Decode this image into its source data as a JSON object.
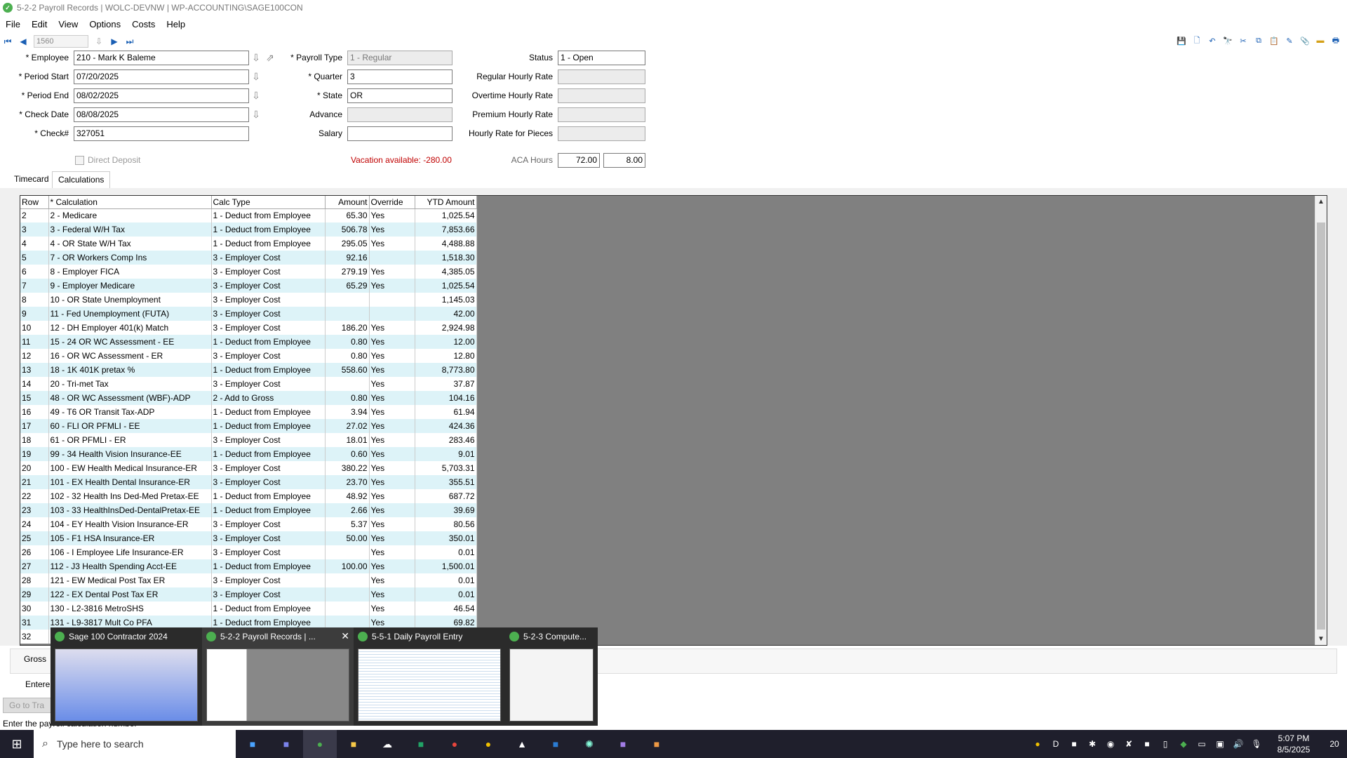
{
  "window": {
    "title": "5-2-2 Payroll Records  |  WOLC-DEVNW  |  WP-ACCOUNTING\\SAGE100CON"
  },
  "menu": [
    "File",
    "Edit",
    "View",
    "Options",
    "Costs",
    "Help"
  ],
  "nav": {
    "record": "1560"
  },
  "form": {
    "employee_label": "* Employee",
    "employee": "210 - Mark K Baleme",
    "period_start_label": "* Period Start",
    "period_start": "07/20/2025",
    "period_end_label": "* Period End",
    "period_end": "08/02/2025",
    "check_date_label": "* Check Date",
    "check_date": "08/08/2025",
    "check_label": "* Check#",
    "check": "327051",
    "direct_deposit_label": "Direct Deposit",
    "payroll_type_label": "* Payroll Type",
    "payroll_type": "1 - Regular",
    "quarter_label": "* Quarter",
    "quarter": "3",
    "state_label": "* State",
    "state": "OR",
    "advance_label": "Advance",
    "advance": "",
    "salary_label": "Salary",
    "salary": "",
    "vacation_label": "Vacation available:",
    "vacation": "-280.00",
    "status_label": "Status",
    "status": "1 - Open",
    "regular_rate_label": "Regular Hourly Rate",
    "overtime_rate_label": "Overtime Hourly Rate",
    "premium_rate_label": "Premium Hourly Rate",
    "pieces_rate_label": "Hourly Rate for Pieces",
    "aca_label": "ACA Hours",
    "aca1": "72.00",
    "aca2": "8.00"
  },
  "tabs": [
    "Timecard",
    "Calculations"
  ],
  "grid": {
    "headers": [
      "Row",
      "* Calculation",
      "Calc Type",
      "Amount",
      "Override",
      "YTD Amount"
    ],
    "rows": [
      [
        "2",
        "2 - Medicare",
        "1 - Deduct from Employee",
        "65.30",
        "Yes",
        "1,025.54"
      ],
      [
        "3",
        "3 - Federal W/H Tax",
        "1 - Deduct from Employee",
        "506.78",
        "Yes",
        "7,853.66"
      ],
      [
        "4",
        "4 - OR State W/H Tax",
        "1 - Deduct from Employee",
        "295.05",
        "Yes",
        "4,488.88"
      ],
      [
        "5",
        "7 - OR Workers Comp Ins",
        "3 - Employer Cost",
        "92.16",
        "",
        "1,518.30"
      ],
      [
        "6",
        "8 - Employer FICA",
        "3 - Employer Cost",
        "279.19",
        "Yes",
        "4,385.05"
      ],
      [
        "7",
        "9 - Employer Medicare",
        "3 - Employer Cost",
        "65.29",
        "Yes",
        "1,025.54"
      ],
      [
        "8",
        "10 - OR State Unemployment",
        "3 - Employer Cost",
        "",
        "",
        "1,145.03"
      ],
      [
        "9",
        "11 - Fed Unemployment (FUTA)",
        "3 - Employer Cost",
        "",
        "",
        "42.00"
      ],
      [
        "10",
        "12 - DH Employer 401(k) Match",
        "3 - Employer Cost",
        "186.20",
        "Yes",
        "2,924.98"
      ],
      [
        "11",
        "15 - 24 OR WC Assessment - EE",
        "1 - Deduct from Employee",
        "0.80",
        "Yes",
        "12.00"
      ],
      [
        "12",
        "16 - OR WC Assessment - ER",
        "3 - Employer Cost",
        "0.80",
        "Yes",
        "12.80"
      ],
      [
        "13",
        "18 - 1K 401K pretax %",
        "1 - Deduct from Employee",
        "558.60",
        "Yes",
        "8,773.80"
      ],
      [
        "14",
        "20 - Tri-met Tax",
        "3 - Employer Cost",
        "",
        "Yes",
        "37.87"
      ],
      [
        "15",
        "48 - OR WC Assessment (WBF)-ADP",
        "2 - Add to Gross",
        "0.80",
        "Yes",
        "104.16"
      ],
      [
        "16",
        "49 - T6 OR Transit Tax-ADP",
        "1 - Deduct from Employee",
        "3.94",
        "Yes",
        "61.94"
      ],
      [
        "17",
        "60 - FLI OR PFMLI - EE",
        "1 - Deduct from Employee",
        "27.02",
        "Yes",
        "424.36"
      ],
      [
        "18",
        "61 - OR PFMLI - ER",
        "3 - Employer Cost",
        "18.01",
        "Yes",
        "283.46"
      ],
      [
        "19",
        "99 - 34 Health Vision Insurance-EE",
        "1 - Deduct from Employee",
        "0.60",
        "Yes",
        "9.01"
      ],
      [
        "20",
        "100 - EW Health Medical Insurance-ER",
        "3 - Employer Cost",
        "380.22",
        "Yes",
        "5,703.31"
      ],
      [
        "21",
        "101 - EX Health Dental Insurance-ER",
        "3 - Employer Cost",
        "23.70",
        "Yes",
        "355.51"
      ],
      [
        "22",
        "102 - 32 Health Ins Ded-Med Pretax-EE",
        "1 - Deduct from Employee",
        "48.92",
        "Yes",
        "687.72"
      ],
      [
        "23",
        "103 - 33 HealthInsDed-DentalPretax-EE",
        "1 - Deduct from Employee",
        "2.66",
        "Yes",
        "39.69"
      ],
      [
        "24",
        "104 - EY Health Vision Insurance-ER",
        "3 - Employer Cost",
        "5.37",
        "Yes",
        "80.56"
      ],
      [
        "25",
        "105 - F1 HSA Insurance-ER",
        "3 - Employer Cost",
        "50.00",
        "Yes",
        "350.01"
      ],
      [
        "26",
        "106 - I Employee Life Insurance-ER",
        "3 - Employer Cost",
        "",
        "Yes",
        "0.01"
      ],
      [
        "27",
        "112 - J3 Health Spending Acct-EE",
        "1 - Deduct from Employee",
        "100.00",
        "Yes",
        "1,500.01"
      ],
      [
        "28",
        "121 - EW Medical Post Tax ER",
        "3 - Employer Cost",
        "",
        "Yes",
        "0.01"
      ],
      [
        "29",
        "122 - EX Dental Post Tax ER",
        "3 - Employer Cost",
        "",
        "Yes",
        "0.01"
      ],
      [
        "30",
        "130 - L2-3816 MetroSHS",
        "1 - Deduct from Employee",
        "",
        "Yes",
        "46.54"
      ],
      [
        "31",
        "131 - L9-3817 Mult Co PFA",
        "1 - Deduct from Employee",
        "",
        "Yes",
        "69.82"
      ],
      [
        "32",
        "",
        "",
        "",
        "",
        ""
      ]
    ]
  },
  "bottom": {
    "gross_label": "Gross",
    "entered_label": "Entere",
    "goto_label": "Go to Tra"
  },
  "statusbar": {
    "text": "Enter the payroll calculation number"
  },
  "previews": [
    {
      "title": "Sage 100 Contractor 2024"
    },
    {
      "title": "5-2-2 Payroll Records | ..."
    },
    {
      "title": "5-5-1 Daily Payroll Entry"
    },
    {
      "title": "5-2-3 Compute..."
    }
  ],
  "taskbar": {
    "search_placeholder": "Type here to search",
    "time": "5:07 PM",
    "date": "8/5/2025",
    "notif": "20",
    "tray_d": "D"
  }
}
